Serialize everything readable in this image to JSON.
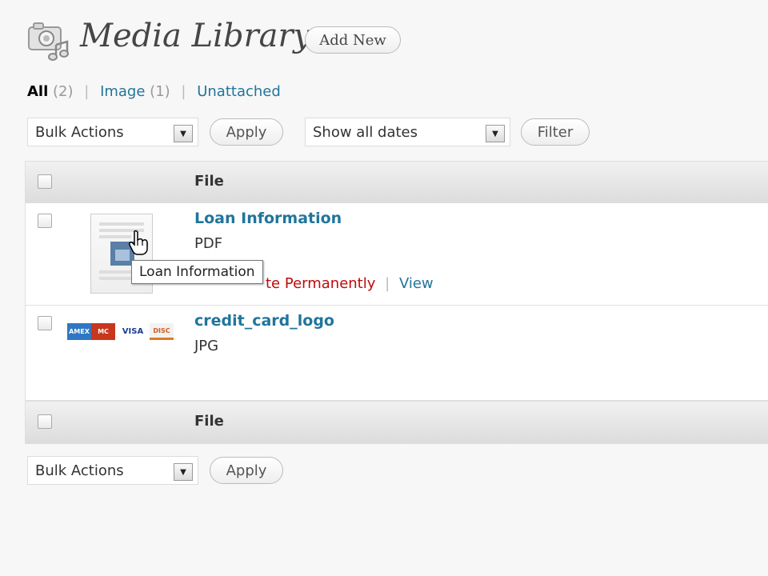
{
  "header": {
    "title": "Media Library",
    "add_new_label": "Add New"
  },
  "filters": {
    "all_label": "All",
    "all_count": "(2)",
    "image_label": "Image",
    "image_count": "(1)",
    "unattached_label": "Unattached",
    "separator": "|"
  },
  "top_controls": {
    "bulk_actions_value": "Bulk Actions",
    "apply_label": "Apply",
    "dates_value": "Show all dates",
    "filter_label": "Filter"
  },
  "table": {
    "column_file": "File",
    "rows": [
      {
        "title": "Loan Information",
        "type": "PDF",
        "action_delete": "te Permanently",
        "action_separator": "|",
        "action_view": "View",
        "tooltip": "Loan Information"
      },
      {
        "title": "credit_card_logo",
        "type": "JPG",
        "card_labels": [
          "AMEX",
          "MC",
          "VISA",
          "DISC"
        ]
      }
    ]
  },
  "bottom_controls": {
    "bulk_actions_value": "Bulk Actions",
    "apply_label": "Apply"
  },
  "colors": {
    "link": "#21759b",
    "delete": "#bc0b0b",
    "background": "#f7f7f7"
  }
}
